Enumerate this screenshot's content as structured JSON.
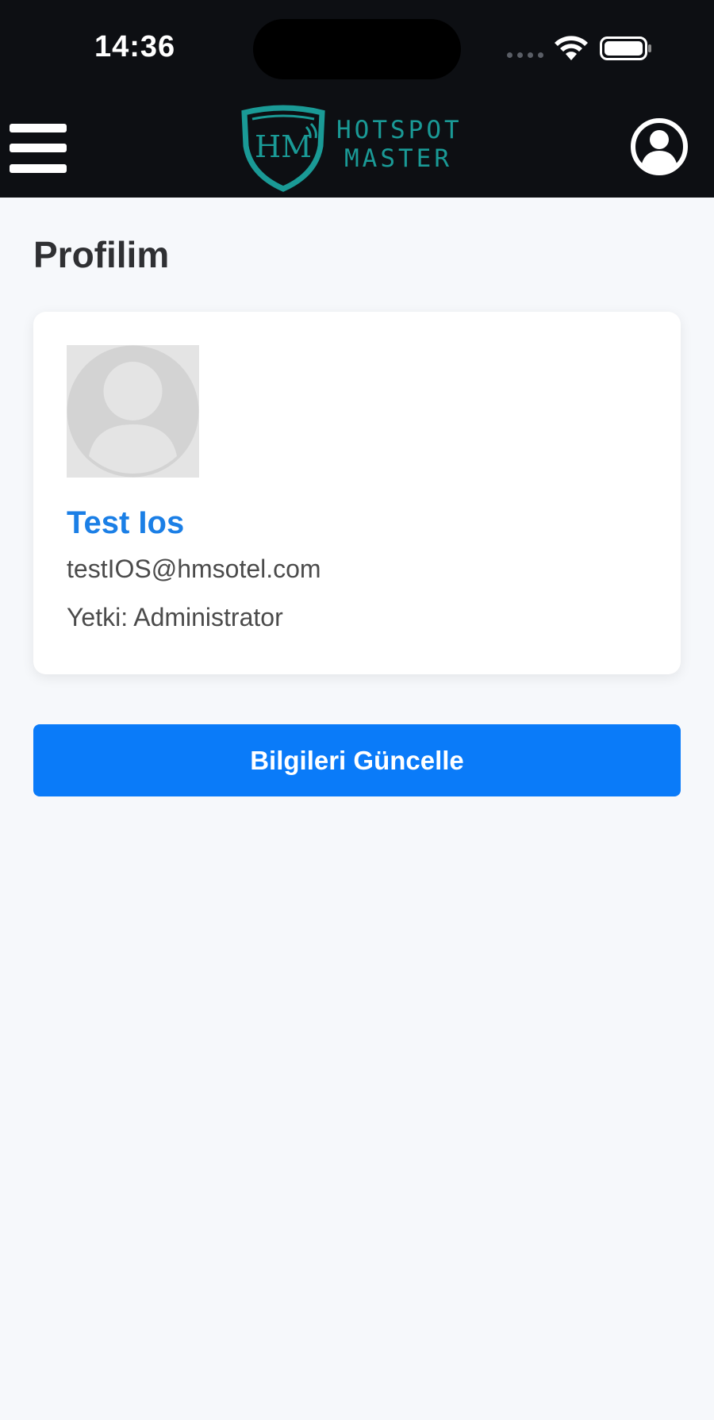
{
  "status_bar": {
    "time": "14:36",
    "icons": [
      "signal-dots-icon",
      "wifi-icon",
      "battery-icon"
    ]
  },
  "header": {
    "menu_icon": "hamburger-menu-icon",
    "logo": {
      "emblem_text": "HM",
      "line1": "HOTSPOT",
      "line2": "MASTER"
    },
    "profile_icon": "user-circle-icon"
  },
  "page": {
    "title": "Profilim"
  },
  "profile_card": {
    "avatar_icon": "avatar-placeholder-icon",
    "name": "Test Ios",
    "email": "testIOS@hmsotel.com",
    "role": "Yetki: Administrator"
  },
  "actions": {
    "update_label": "Bilgileri Güncelle"
  },
  "colors": {
    "header_bg": "#0d0f13",
    "page_bg": "#f6f8fb",
    "brand_teal": "#1a9a96",
    "name_blue": "#1b7fe6",
    "button_blue": "#0a7bf9"
  }
}
